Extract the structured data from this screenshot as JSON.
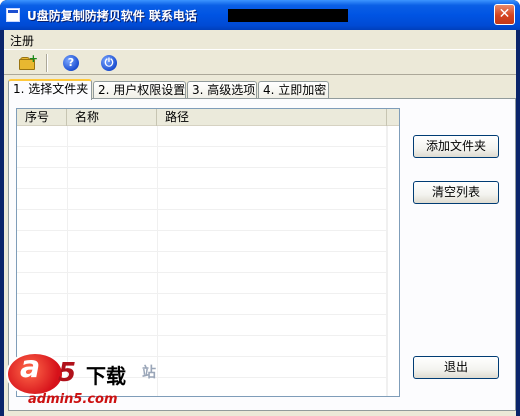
{
  "window": {
    "title": "U盘防复制防拷贝软件  联系电话",
    "close_glyph": "✕"
  },
  "menu": {
    "items": [
      {
        "label": "注册"
      }
    ]
  },
  "toolbar": {
    "buttons": [
      {
        "icon": "add-folder-icon"
      },
      {
        "icon": "help-icon",
        "glyph": "?"
      },
      {
        "icon": "power-icon",
        "glyph": "⏻"
      }
    ]
  },
  "tabs": [
    {
      "label": "1. 选择文件夹",
      "active": true
    },
    {
      "label": "2. 用户权限设置",
      "active": false
    },
    {
      "label": "3. 高级选项",
      "active": false
    },
    {
      "label": "4. 立即加密",
      "active": false
    }
  ],
  "list": {
    "columns": [
      "序号",
      "名称",
      "路径"
    ],
    "rows": []
  },
  "buttons": {
    "add_folder": "添加文件夹",
    "clear_list": "清空列表",
    "exit": "退出"
  },
  "watermark": {
    "logo_letter": "a",
    "logo_digit": "5",
    "brand": "下载",
    "partial": "站",
    "url": "admin5.com"
  },
  "colors": {
    "titlebar": "#0054e3",
    "face": "#ece9d8",
    "active_tab_accent": "#ffc83c"
  }
}
